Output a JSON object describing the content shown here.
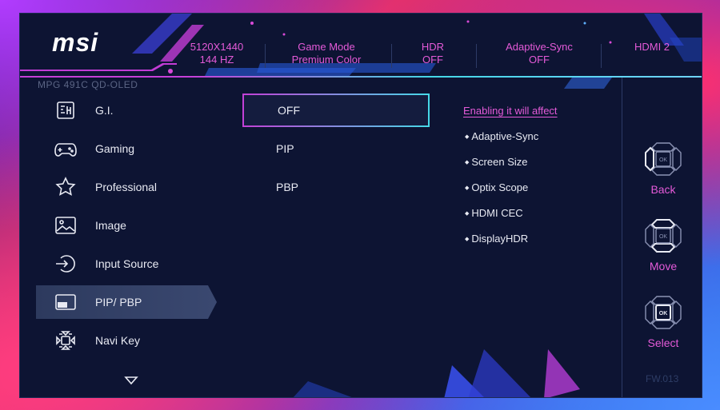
{
  "header": {
    "logo": "msi",
    "model": "MPG 491C QD-OLED",
    "stats": [
      {
        "line1": "5120X1440",
        "line2": "144 HZ"
      },
      {
        "line1": "Game Mode",
        "line2": "Premium Color"
      },
      {
        "line1": "HDR",
        "line2": "OFF"
      },
      {
        "line1": "Adaptive-Sync",
        "line2": "OFF"
      },
      {
        "line1": "HDMI 2",
        "line2": ""
      }
    ]
  },
  "menu": {
    "items": [
      {
        "label": "G.I.",
        "icon": "gi-chip-icon"
      },
      {
        "label": "Gaming",
        "icon": "gamepad-icon"
      },
      {
        "label": "Professional",
        "icon": "star-icon"
      },
      {
        "label": "Image",
        "icon": "image-icon"
      },
      {
        "label": "Input Source",
        "icon": "input-source-icon"
      },
      {
        "label": "PIP/ PBP",
        "icon": "pip-icon"
      },
      {
        "label": "Navi Key",
        "icon": "navi-key-icon"
      }
    ],
    "active_index": 5,
    "scroll_icon": "chevron-down-icon"
  },
  "options": {
    "items": [
      "OFF",
      "PIP",
      "PBP"
    ],
    "selected_index": 0
  },
  "info": {
    "title": "Enabling it will affect",
    "items": [
      "Adaptive-Sync",
      "Screen Size",
      "Optix Scope",
      "HDMI CEC",
      "DisplayHDR"
    ]
  },
  "controls": {
    "back_label": "Back",
    "move_label": "Move",
    "select_label": "Select",
    "ok_text": "OK"
  },
  "firmware": "FW.013",
  "colors": {
    "accent_pink": "#e45ad8",
    "accent_cyan": "#44d7e6",
    "panel_bg": "#0d1433",
    "active_item_bg": "#3a4870"
  }
}
